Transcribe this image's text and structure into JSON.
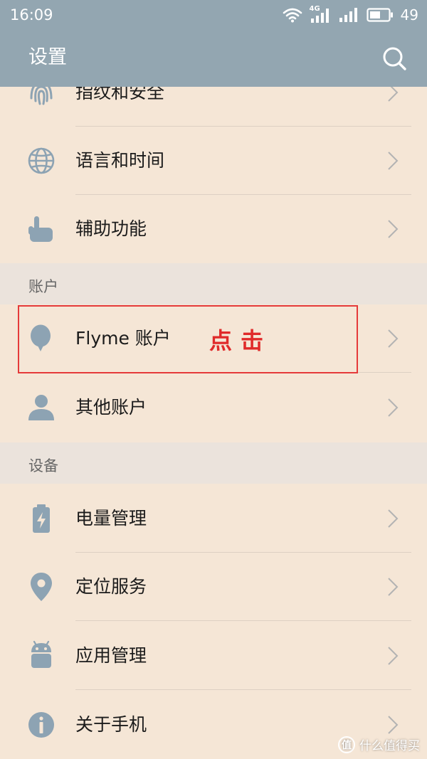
{
  "status_bar": {
    "time": "16:09",
    "network_label": "4G",
    "battery_level": "49"
  },
  "header": {
    "title": "设置"
  },
  "items": {
    "fingerprint": "指纹和安全",
    "language": "语言和时间",
    "accessibility": "辅助功能",
    "flyme_account": "Flyme 账户",
    "other_accounts": "其他账户",
    "battery": "电量管理",
    "location": "定位服务",
    "apps": "应用管理",
    "about": "关于手机"
  },
  "sections": {
    "accounts": "账户",
    "device": "设备"
  },
  "annotation": {
    "text": "点击",
    "color": "#e53a3a"
  },
  "watermark": {
    "logo": "值",
    "text": "什么值得买"
  },
  "colors": {
    "bar": "#93a6b1",
    "background": "#f5e6d6",
    "icon": "#8da3b3"
  }
}
